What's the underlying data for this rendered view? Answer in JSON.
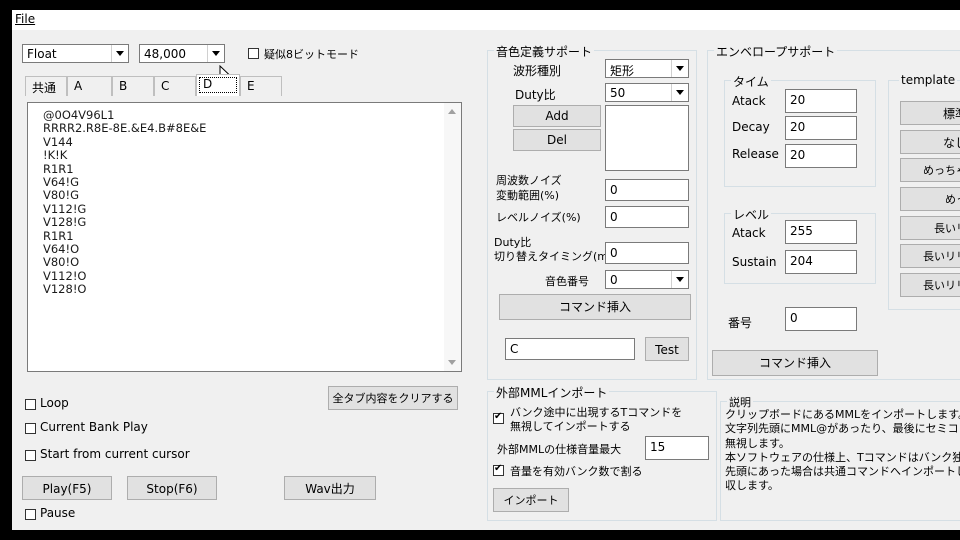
{
  "menu": {
    "file": "File"
  },
  "top": {
    "format_value": "Float",
    "rate_value": "48,000",
    "pseudo8bit_label": "疑似8ビットモード"
  },
  "tabs": [
    {
      "label": "共通"
    },
    {
      "label": "A"
    },
    {
      "label": "B"
    },
    {
      "label": "C"
    },
    {
      "label": "D"
    },
    {
      "label": "E"
    }
  ],
  "editor": {
    "lines": [
      "@0O4V96L1",
      "RRRR2.R8E-8E.&E4.B#8E&E",
      "V144",
      "!K!K",
      "R1R1",
      "V64!G",
      "V80!G",
      "V112!G",
      "V128!G",
      "R1R1",
      "V64!O",
      "V80!O",
      "V112!O",
      "V128!O"
    ]
  },
  "left": {
    "loop": "Loop",
    "current_bank": "Current Bank Play",
    "start_cursor": "Start from current cursor",
    "clear_all": "全タブ内容をクリアする",
    "play": "Play(F5)",
    "stop": "Stop(F6)",
    "wav": "Wav出力",
    "pause": "Pause"
  },
  "tone": {
    "title": "音色定義サポート",
    "wave_label": "波形種別",
    "wave_value": "矩形",
    "duty_label": "Duty比",
    "duty_value": "50",
    "add": "Add",
    "del": "Del",
    "noise_label1": "周波数ノイズ",
    "noise_label2": "変動範囲(%)",
    "noise_value": "0",
    "level_noise_label": "レベルノイズ(%)",
    "level_noise_value": "0",
    "duty_switch_label1": "Duty比",
    "duty_switch_label2": "切り替えタイミング(ms)",
    "duty_switch_value": "0",
    "tone_no_label": "音色番号",
    "tone_no_value": "0",
    "insert": "コマンド挿入",
    "test_value": "C",
    "test": "Test"
  },
  "envelope": {
    "title": "エンベロープサポート",
    "time_title": "タイム",
    "atack_label": "Atack",
    "atack_value": "20",
    "decay_label": "Decay",
    "decay_value": "20",
    "release_label": "Release",
    "release_value": "20",
    "level_title": "レベル",
    "level_atack_label": "Atack",
    "level_atack_value": "255",
    "sustain_label": "Sustain",
    "sustain_value": "204",
    "number_label": "番号",
    "number_value": "0",
    "insert": "コマンド挿入",
    "template_title": "template",
    "templates": [
      "標準",
      "なし",
      "めっちゃ",
      "めっ",
      "長いリ",
      "長いリリ",
      "長いリリ"
    ]
  },
  "import": {
    "title": "外部MMLインポート",
    "bank_t_label1": "バンク途中に出現するTコマンドを",
    "bank_t_label2": "無視してインポートする",
    "max_vol_label": "外部MMLの仕様音量最大",
    "max_vol_value": "15",
    "divide_label": "音量を有効バンク数で割る",
    "import_button": "インポート"
  },
  "description": {
    "title": "説明",
    "lines": [
      "クリップボードにあるMMLをインポートします。",
      "文字列先頭にMML@があったり、最後にセミコロン",
      "無視します。",
      "本ソフトウェアの仕様上、Tコマンドはバンク独立し",
      "先頭にあった場合は共通コマンドへインポートしそ",
      "収します。"
    ]
  }
}
